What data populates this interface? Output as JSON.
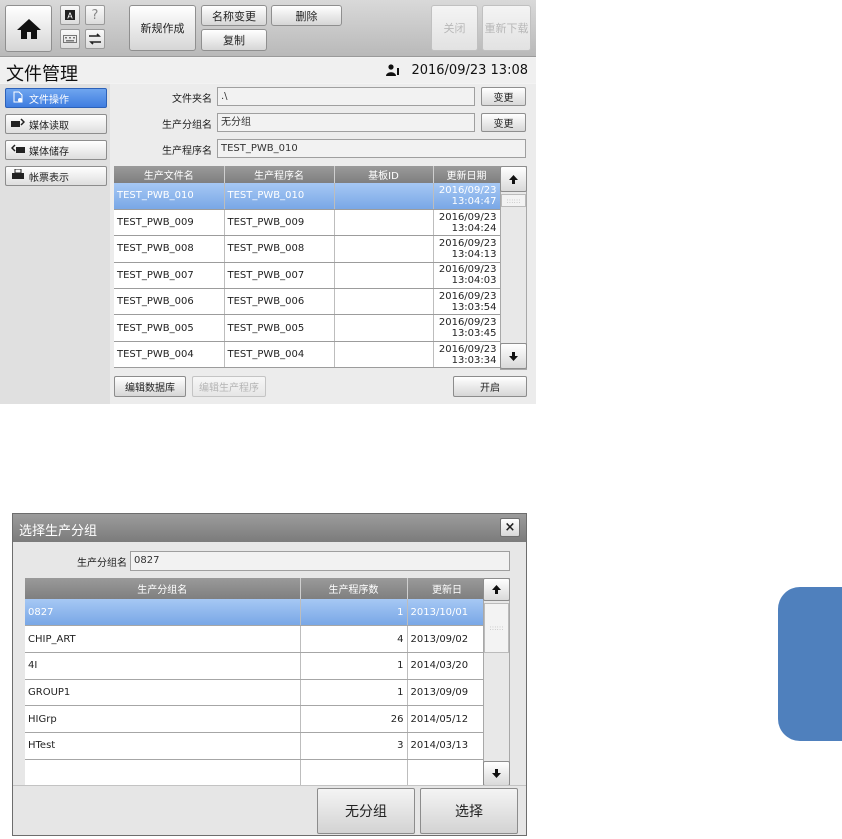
{
  "toolbar": {
    "new_label": "新规作成",
    "rename_label": "名称变更",
    "delete_label": "删除",
    "copy_label": "复制",
    "close_label": "关闭",
    "reload_label": "重新下载"
  },
  "header": {
    "title": "文件管理",
    "datetime": "2016/09/23 13:08"
  },
  "sidebar": {
    "items": [
      {
        "label": "文件操作"
      },
      {
        "label": "媒体读取"
      },
      {
        "label": "媒体储存"
      },
      {
        "label": "帐票表示"
      }
    ]
  },
  "form": {
    "folder_label": "文件夹名",
    "folder_value": ".\\",
    "group_label": "生产分组名",
    "group_value": "无分组",
    "program_label": "生产程序名",
    "program_value": "TEST_PWB_010",
    "change_label": "变更"
  },
  "file_table": {
    "columns": [
      "生产文件名",
      "生产程序名",
      "基板ID",
      "更新日期"
    ],
    "rows": [
      {
        "file": "TEST_PWB_010",
        "program": "TEST_PWB_010",
        "board_id": "",
        "date": "2016/09/23",
        "time": "13:04:47"
      },
      {
        "file": "TEST_PWB_009",
        "program": "TEST_PWB_009",
        "board_id": "",
        "date": "2016/09/23",
        "time": "13:04:24"
      },
      {
        "file": "TEST_PWB_008",
        "program": "TEST_PWB_008",
        "board_id": "",
        "date": "2016/09/23",
        "time": "13:04:13"
      },
      {
        "file": "TEST_PWB_007",
        "program": "TEST_PWB_007",
        "board_id": "",
        "date": "2016/09/23",
        "time": "13:04:03"
      },
      {
        "file": "TEST_PWB_006",
        "program": "TEST_PWB_006",
        "board_id": "",
        "date": "2016/09/23",
        "time": "13:03:54"
      },
      {
        "file": "TEST_PWB_005",
        "program": "TEST_PWB_005",
        "board_id": "",
        "date": "2016/09/23",
        "time": "13:03:45"
      },
      {
        "file": "TEST_PWB_004",
        "program": "TEST_PWB_004",
        "board_id": "",
        "date": "2016/09/23",
        "time": "13:03:34"
      }
    ]
  },
  "actions": {
    "edit_db_label": "编辑数据库",
    "edit_program_label": "编辑生产程序",
    "open_label": "开启"
  },
  "dialog": {
    "title": "选择生产分组",
    "group_label": "生产分组名",
    "group_value": "0827",
    "columns": [
      "生产分组名",
      "生产程序数",
      "更新日"
    ],
    "rows": [
      {
        "name": "0827",
        "count": "1",
        "date": "2013/10/01"
      },
      {
        "name": "CHIP_ART",
        "count": "4",
        "date": "2013/09/02"
      },
      {
        "name": "4I",
        "count": "1",
        "date": "2014/03/20"
      },
      {
        "name": "GROUP1",
        "count": "1",
        "date": "2013/09/09"
      },
      {
        "name": "HIGrp",
        "count": "26",
        "date": "2014/05/12"
      },
      {
        "name": "HTest",
        "count": "3",
        "date": "2014/03/13"
      },
      {
        "name": "",
        "count": "",
        "date": ""
      }
    ],
    "no_group_label": "无分组",
    "select_label": "选择",
    "close_icon": "×"
  },
  "colors": {
    "selection": "#7aa8e6",
    "accent_tab": "#4f80bd",
    "header_gray": "#8a8a8a"
  }
}
